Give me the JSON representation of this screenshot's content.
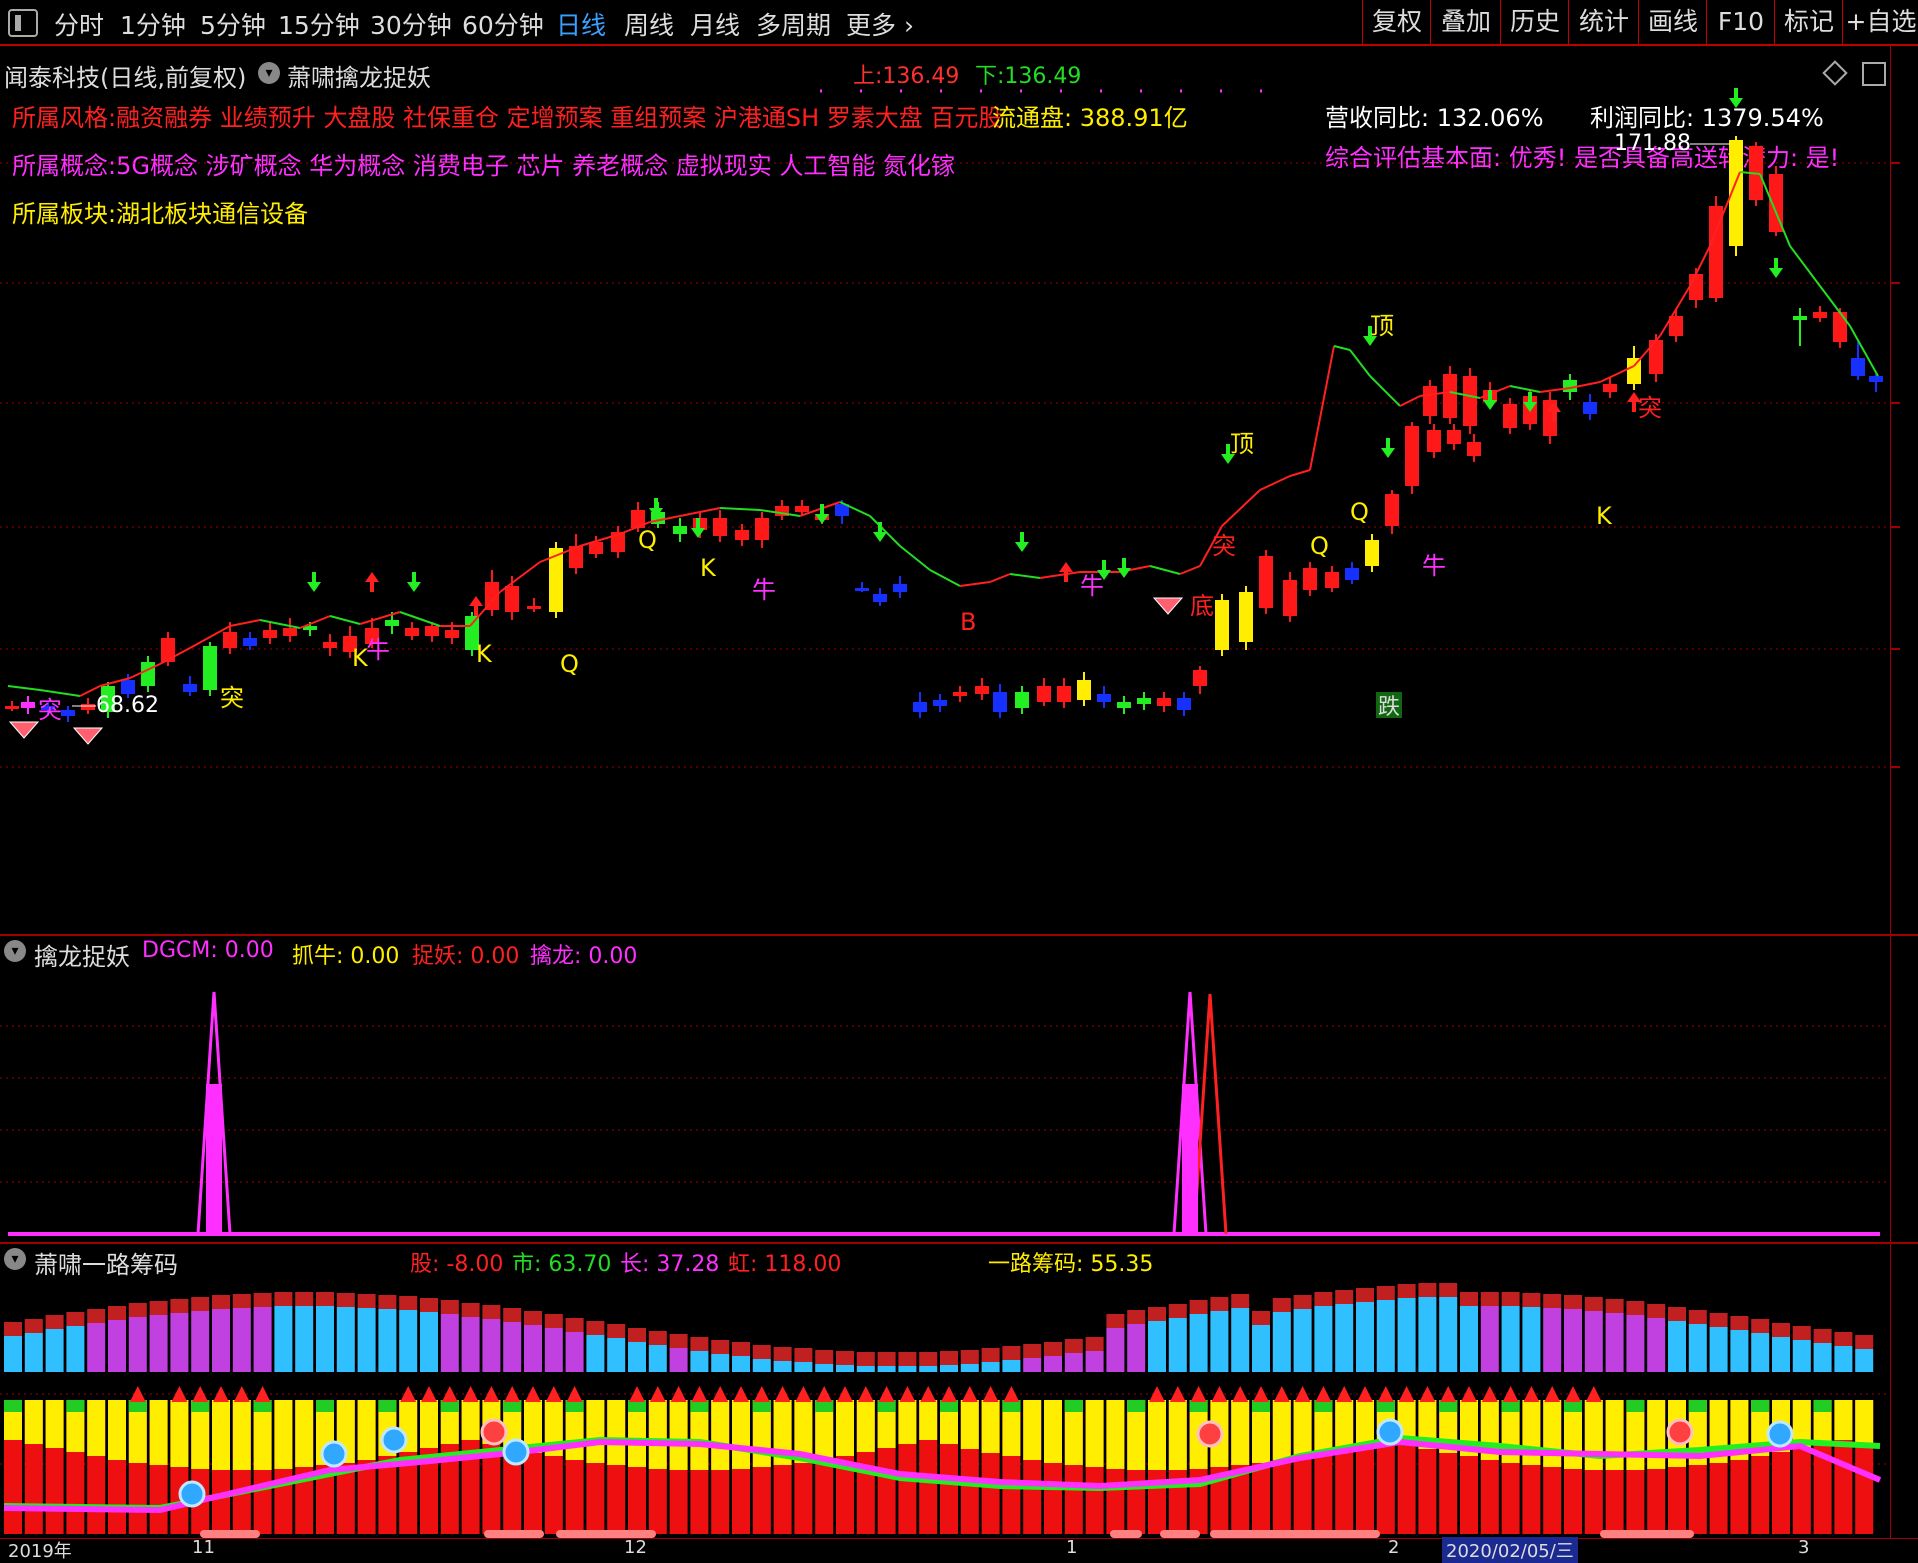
{
  "toolbar": {
    "periods": [
      "分时",
      "1分钟",
      "5分钟",
      "15分钟",
      "30分钟",
      "60分钟",
      "日线",
      "周线",
      "月线",
      "多周期",
      "更多"
    ],
    "right_buttons": [
      "复权",
      "叠加",
      "历史",
      "统计",
      "画线",
      "F10",
      "标记",
      "+自选"
    ],
    "active_period": "日线"
  },
  "main_chart": {
    "title": "闻泰科技(日线,前复权)",
    "indicator_name": "萧啸擒龙捉妖",
    "upper_label": "上:136.49",
    "lower_label": "下:136.49",
    "style_line": "所属风格:融资融券 业绩预升 大盘股 社保重仓 定增预案 重组预案 沪港通SH 罗素大盘 百元股",
    "float_label": "流通盘: 388.91亿",
    "concept_line": "所属概念:5G概念 涉矿概念 华为概念 消费电子 芯片 养老概念 虚拟现实 人工智能 氮化镓",
    "sector_line": "所属板块:湖北板块通信设备",
    "revenue_yoy": "营收同比: 132.06%",
    "profit_yoy": "利润同比: 1379.54%",
    "assessment": "综合评估基本面: 优秀! 是否具备高送转潜力: 是!",
    "high_label": "171.88",
    "low_label": "68.62",
    "markers": {
      "top": "顶",
      "q": "Q",
      "k": "K",
      "niu": "牛",
      "tu": "突",
      "di": "底",
      "b": "B",
      "die": "跌"
    }
  },
  "sub1": {
    "name": "擒龙捉妖",
    "dgcm": "DGCM: 0.00",
    "zhuaniu": "抓牛: 0.00",
    "zhuoyao": "捉妖: 0.00",
    "qinlong": "擒龙: 0.00"
  },
  "sub2": {
    "name": "萧啸一路筹码",
    "gu": "股: -8.00",
    "shi": "市: 63.70",
    "chang": "长: 37.28",
    "hong": "虹: 118.00",
    "yilu": "一路筹码: 55.35"
  },
  "xaxis": {
    "labels": [
      "2019年",
      "11",
      "12",
      "1",
      "2",
      "2020/02/05/三",
      "3"
    ]
  },
  "colors": {
    "up": "#ff2020",
    "down_blue": "#1530ff",
    "green": "#22dd22",
    "yellow": "#ffee00",
    "magenta": "#ff30ff",
    "cyan": "#30c0ff",
    "red_grid": "#a00000"
  }
}
